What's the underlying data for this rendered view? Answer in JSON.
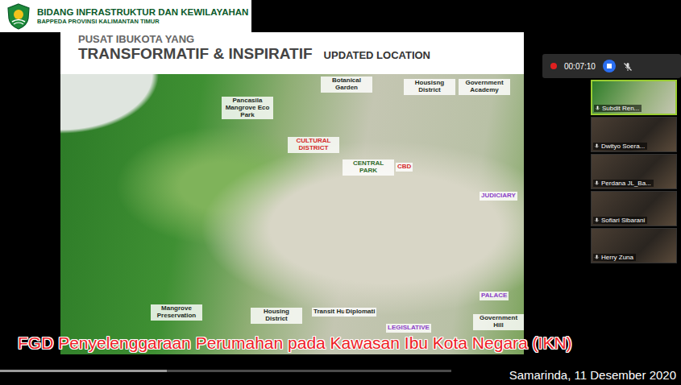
{
  "banner": {
    "title": "BIDANG INFRASTRUKTUR DAN KEWILAYAHAN",
    "subtitle": "BAPPEDA PROVINSI KALIMANTAN TIMUR"
  },
  "slide": {
    "title_line1": "PUSAT IBUKOTA YANG",
    "title_line2": "TRANSFORMATIF & INSPIRATIF",
    "tag": "UPDATED LOCATION",
    "labels": [
      {
        "text": "Botanical Garden",
        "color": "#1e2b1e"
      },
      {
        "text": "Housisng District",
        "color": "#1e2b1e"
      },
      {
        "text": "Government Academy",
        "color": "#1e2b1e"
      },
      {
        "text": "Pancasila Mangrove Eco Park",
        "color": "#1e2b1e"
      },
      {
        "text": "CULTURAL DISTRICT",
        "color": "#d42a2a"
      },
      {
        "text": "CENTRAL PARK",
        "color": "#2e6b2a"
      },
      {
        "text": "CBD",
        "color": "#d42a2a"
      },
      {
        "text": "JUDICIARY",
        "color": "#8b3fc7"
      },
      {
        "text": "PALACE",
        "color": "#8b3fc7"
      },
      {
        "text": "Mangrove Preservation",
        "color": "#1e2b1e"
      },
      {
        "text": "Housing District",
        "color": "#1e2b1e"
      },
      {
        "text": "Transit Hub",
        "color": "#1e2b1e"
      },
      {
        "text": "Diplomati",
        "color": "#1e2b1e"
      },
      {
        "text": "LEGISLATIVE",
        "color": "#8b3fc7"
      },
      {
        "text": "Government Hill",
        "color": "#1e2b1e"
      }
    ]
  },
  "recording": {
    "on": true,
    "time": "00:07:10",
    "mic_muted": true
  },
  "participants": [
    {
      "name": "Subdit Ren...",
      "selected": true
    },
    {
      "name": "Dwityo Soera...",
      "selected": false
    },
    {
      "name": "Perdana JL_Ba...",
      "selected": false
    },
    {
      "name": "Sofiari Sibarani",
      "selected": false
    },
    {
      "name": "Herry Zuna",
      "selected": false
    }
  ],
  "caption": "FGD Penyelenggaraan Perumahan pada Kawasan Ibu Kota Negara (IKN)",
  "date_line": "Samarinda, 11 Desember 2020",
  "playback": {
    "level": 0.37
  }
}
